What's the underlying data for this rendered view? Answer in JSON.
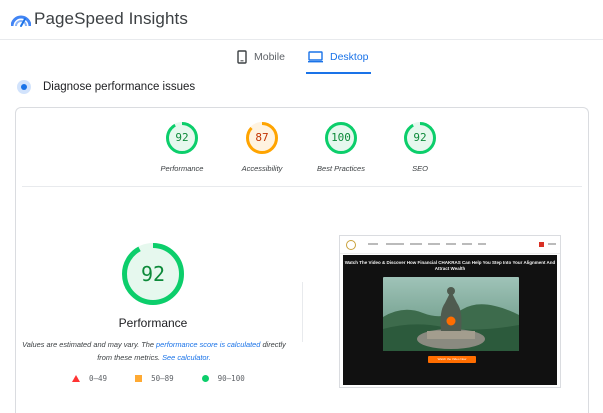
{
  "app": {
    "title": "PageSpeed Insights",
    "icon": "pagespeed-logo-icon"
  },
  "tabs": [
    {
      "label": "Mobile",
      "icon": "phone-icon",
      "selected": false
    },
    {
      "label": "Desktop",
      "icon": "monitor-icon",
      "selected": true
    }
  ],
  "diagnose": {
    "title": "Diagnose performance issues",
    "icon": "diagnose-icon"
  },
  "scores": [
    {
      "value": "92",
      "label": "Performance",
      "status": "pass",
      "fraction": 0.92,
      "color": "#0cce6b"
    },
    {
      "value": "87",
      "label": "Accessibility",
      "status": "average",
      "fraction": 0.87,
      "color": "#ffa400"
    },
    {
      "value": "100",
      "label": "Best Practices",
      "status": "pass",
      "fraction": 1.0,
      "color": "#0cce6b"
    },
    {
      "value": "92",
      "label": "SEO",
      "status": "pass",
      "fraction": 0.92,
      "color": "#0cce6b"
    }
  ],
  "main": {
    "score": "92",
    "fraction": 0.92,
    "label": "Performance",
    "description_1": "Values are estimated and may vary. The ",
    "link_1": "performance score is calculated",
    "description_2": " directly from these metrics. ",
    "link_2": "See calculator."
  },
  "legend": [
    {
      "range": "0–49",
      "shape": "triangle",
      "color": "#ff3333"
    },
    {
      "range": "50–89",
      "shape": "square",
      "color": "#ffaa33"
    },
    {
      "range": "90–100",
      "shape": "circle",
      "color": "#0cce6b"
    }
  ],
  "preview": {
    "headline": "Watch The Video & Discover How Financial CHAKRAS Can Help You Step Into Your Alignment And Attract Wealth",
    "button": "Watch the Video Now",
    "accent": "#ff6d00"
  }
}
